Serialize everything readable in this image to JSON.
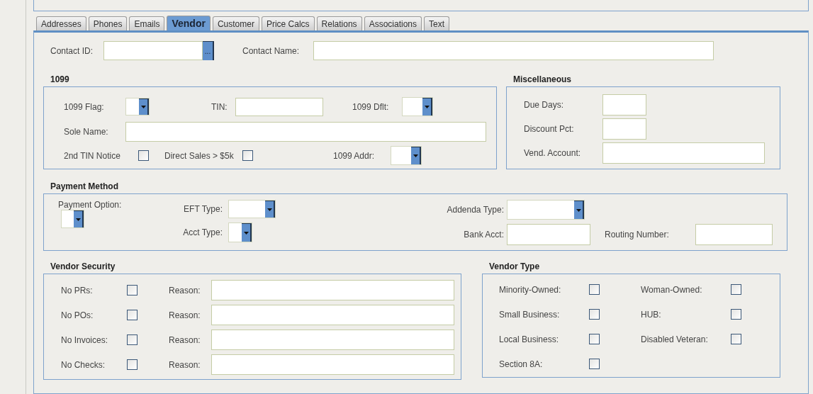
{
  "tabs": [
    {
      "label": "Addresses",
      "selected": false
    },
    {
      "label": "Phones",
      "selected": false
    },
    {
      "label": "Emails",
      "selected": false
    },
    {
      "label": "Vendor",
      "selected": true
    },
    {
      "label": "Customer",
      "selected": false
    },
    {
      "label": "Price Calcs",
      "selected": false
    },
    {
      "label": "Relations",
      "selected": false
    },
    {
      "label": "Associations",
      "selected": false
    },
    {
      "label": "Text",
      "selected": false
    }
  ],
  "contact": {
    "id_label": "Contact ID:",
    "lookup_button": "...",
    "name_label": "Contact Name:"
  },
  "section_1099": {
    "title": "1099",
    "flag_label": "1099 Flag:",
    "tin_label": "TIN:",
    "dflt_label": "1099 Dflt:",
    "sole_name_label": "Sole Name:",
    "tin_notice": {
      "label": "2nd TIN Notice",
      "checked": false
    },
    "direct_sales": {
      "label": "Direct Sales > $5k",
      "checked": false
    },
    "addr_label": "1099 Addr:"
  },
  "miscellaneous": {
    "title": "Miscellaneous",
    "fields": [
      {
        "label": "Due Days:",
        "kind": "short"
      },
      {
        "label": "Discount Pct:",
        "kind": "short"
      },
      {
        "label": "Vend. Account:",
        "kind": "wide"
      }
    ]
  },
  "payment_method": {
    "title": "Payment Method",
    "option_label": "Payment Option:",
    "eft_type_label": "EFT Type:",
    "acct_type_label": "Acct Type:",
    "addenda_type_label": "Addenda Type:",
    "bank_acct_label": "Bank Acct:",
    "routing_number_label": "Routing Number:"
  },
  "vendor_security": {
    "title": "Vendor Security",
    "rows": [
      {
        "label": "No PRs:",
        "checked": false,
        "reason_label": "Reason:"
      },
      {
        "label": "No POs:",
        "checked": false,
        "reason_label": "Reason:"
      },
      {
        "label": "No Invoices:",
        "checked": false,
        "reason_label": "Reason:"
      },
      {
        "label": "No Checks:",
        "checked": false,
        "reason_label": "Reason:"
      }
    ]
  },
  "vendor_type": {
    "title": "Vendor Type",
    "items": [
      {
        "label": "Minority-Owned:",
        "checked": false
      },
      {
        "label": "Woman-Owned:",
        "checked": false
      },
      {
        "label": "Small Business:",
        "checked": false
      },
      {
        "label": "HUB:",
        "checked": false
      },
      {
        "label": "Local Business:",
        "checked": false
      },
      {
        "label": "Disabled Veteran:",
        "checked": false
      },
      {
        "label": "Section 8A:",
        "checked": false
      }
    ]
  }
}
